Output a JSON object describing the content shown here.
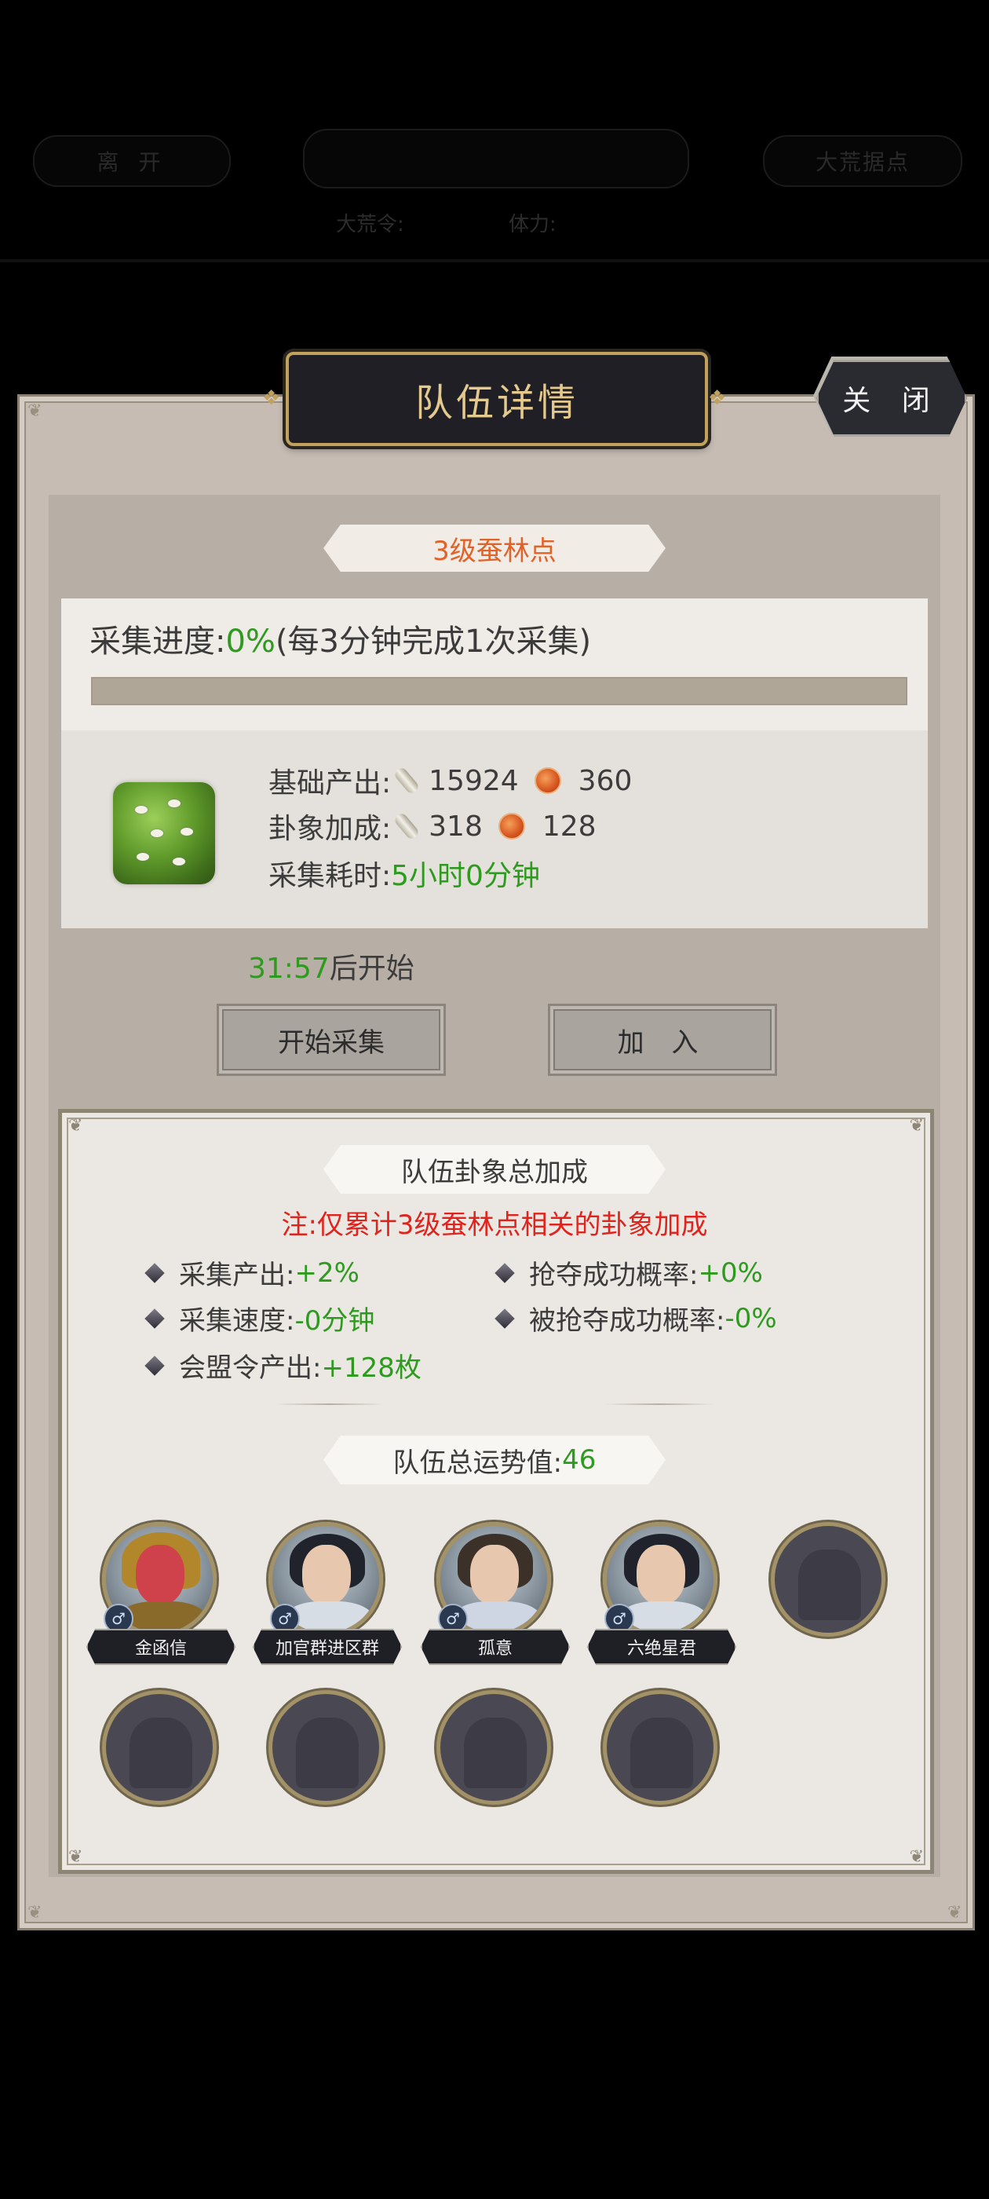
{
  "background_bar": {
    "leave_label": "离 开",
    "right_label": "大荒据点",
    "order_label": "大荒令:",
    "stamina_label": "体力:"
  },
  "modal": {
    "title": "队伍详情",
    "close_label": "关 闭"
  },
  "point": {
    "name": "3级蚕林点",
    "progress_label": "采集进度:",
    "progress_value": "0%",
    "progress_note": "(每3分钟完成1次采集)",
    "progress_fraction": 0
  },
  "output": {
    "base_label": "基础产出:",
    "base_silk": "15924",
    "base_coin": "360",
    "hex_label": "卦象加成:",
    "hex_silk": "318",
    "hex_coin": "128",
    "time_label": "采集耗时:",
    "time_value": "5小时0分钟"
  },
  "timer": {
    "countdown": "31:57",
    "suffix": "后开始"
  },
  "buttons": {
    "start_label": "开始采集",
    "join_label": "加 入"
  },
  "bonus": {
    "header": "队伍卦象总加成",
    "note": "注:仅累计3级蚕林点相关的卦象加成",
    "stats": [
      {
        "label": "采集产出:",
        "value": "+2%"
      },
      {
        "label": "抢夺成功概率:",
        "value": "+0%"
      },
      {
        "label": "采集速度:",
        "value": "-0分钟"
      },
      {
        "label": "被抢夺成功概率:",
        "value": "-0%"
      },
      {
        "label": "会盟令产出:",
        "value": "+128枚"
      }
    ],
    "fortune_label": "队伍总运势值:",
    "fortune_value": "46"
  },
  "members": [
    {
      "name": "金函信",
      "gender": "♂"
    },
    {
      "name": "加官群进区群",
      "gender": "♂"
    },
    {
      "name": "孤意",
      "gender": "♂"
    },
    {
      "name": "六绝星君",
      "gender": "♂"
    }
  ]
}
